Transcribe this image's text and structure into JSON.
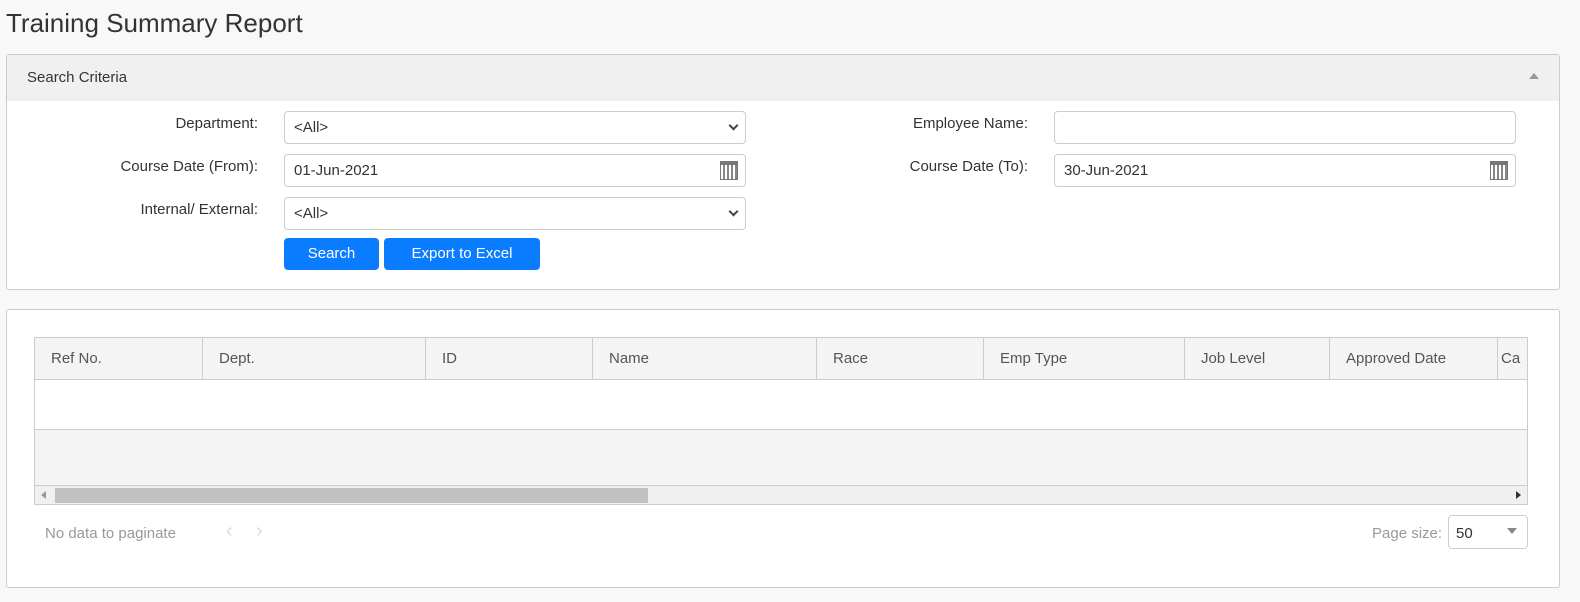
{
  "page": {
    "title": "Training Summary Report"
  },
  "search": {
    "header": "Search Criteria",
    "department_label": "Department:",
    "department_value": "<All>",
    "employee_name_label": "Employee Name:",
    "employee_name_value": "",
    "date_from_label": "Course Date (From):",
    "date_from_value": "01-Jun-2021",
    "date_to_label": "Course Date (To):",
    "date_to_value": "30-Jun-2021",
    "int_ext_label": "Internal/ External:",
    "int_ext_value": "<All>",
    "search_button": "Search",
    "export_button": "Export to Excel"
  },
  "grid": {
    "columns": [
      "Ref No.",
      "Dept.",
      "ID",
      "Name",
      "Race",
      "Emp Type",
      "Job Level",
      "Approved Date",
      "Ca"
    ]
  },
  "pager": {
    "info": "No data to paginate",
    "page_size_label": "Page size:",
    "page_size_value": "50"
  },
  "colors": {
    "accent": "#0a7cff"
  }
}
